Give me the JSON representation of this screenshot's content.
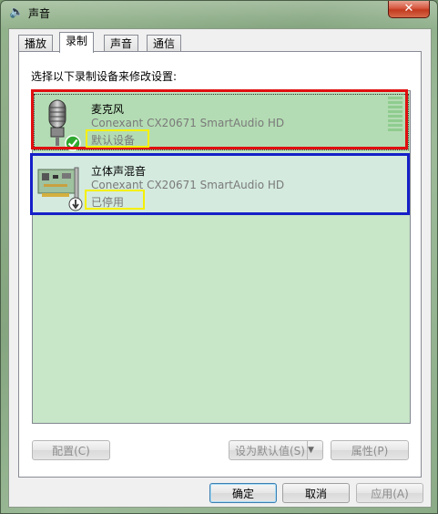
{
  "window": {
    "title": "声音",
    "close_glyph": "✕"
  },
  "tabs": [
    {
      "label": "播放",
      "active": false
    },
    {
      "label": "录制",
      "active": true
    },
    {
      "label": "声音",
      "active": false
    },
    {
      "label": "通信",
      "active": false
    }
  ],
  "recording": {
    "prompt": "选择以下录制设备来修改设置:",
    "devices": [
      {
        "name": "麦克风",
        "driver": "Conexant CX20671 SmartAudio HD",
        "status": "默认设备",
        "icon": "microphone-icon",
        "badge": "default-device-check-icon",
        "selected": true
      },
      {
        "name": "立体声混音",
        "driver": "Conexant CX20671 SmartAudio HD",
        "status": "已停用",
        "icon": "sound-card-icon",
        "badge": "disabled-down-arrow-icon",
        "selected": false
      }
    ]
  },
  "buttons": {
    "configure": "配置(C)",
    "set_default": "设为默认值(S)",
    "properties": "属性(P)",
    "ok": "确定",
    "cancel": "取消",
    "apply": "应用(A)"
  },
  "annotation_colors": {
    "red": "#e01010",
    "blue": "#1520c8",
    "yellow": "#f4f000"
  }
}
